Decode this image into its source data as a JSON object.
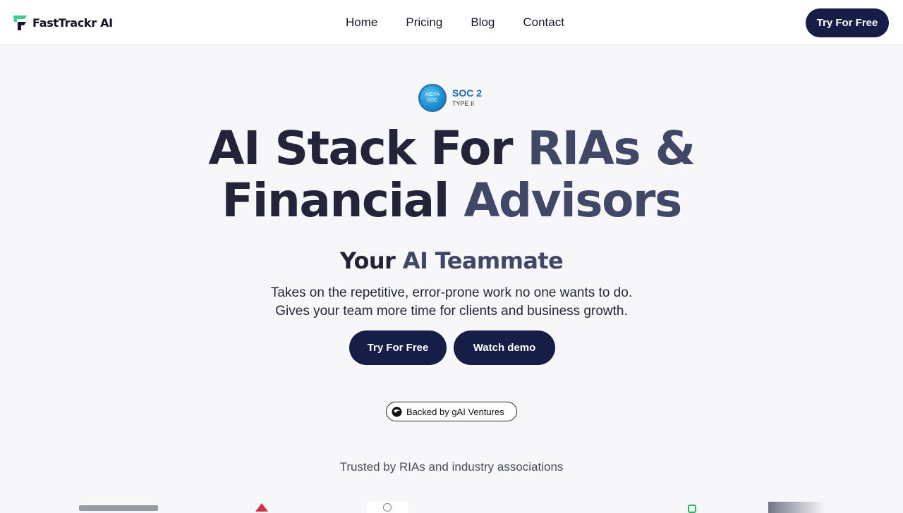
{
  "header": {
    "brand": "FastTrackr AI",
    "nav": [
      {
        "label": "Home"
      },
      {
        "label": "Pricing"
      },
      {
        "label": "Blog"
      },
      {
        "label": "Contact"
      }
    ],
    "cta_label": "Try For Free"
  },
  "soc_badge": {
    "seal_top": "AICPA",
    "seal_bottom": "SOC",
    "title": "SOC 2",
    "subtitle": "TYPE II"
  },
  "hero": {
    "title_line1_a": "AI Stack For ",
    "title_line1_b": "RIAs &",
    "title_line2_a": "Financial ",
    "title_line2_b": "Advisors",
    "subtitle_a": "Your ",
    "subtitle_b": "AI Teammate",
    "description_line1": "Takes on the repetitive, error-prone work no one wants to do.",
    "description_line2": "Gives your team more time for clients and business growth.",
    "primary_cta": "Try For Free",
    "secondary_cta": "Watch demo"
  },
  "backed_badge": {
    "label": "Backed by gAI Ventures"
  },
  "trusted": {
    "label": "Trusted by RIAs and industry associations"
  },
  "colors": {
    "accent_navy": "#161d46",
    "brand_green": "#3ccf8e",
    "title_dark": "#23233a",
    "title_muted": "#414867",
    "page_bg": "#f7f7f9"
  },
  "icons": {
    "brand_logo": "fasttrackr-logo-icon",
    "backed_logo": "gai-ventures-icon",
    "soc_seal": "aicpa-soc-seal-icon"
  }
}
